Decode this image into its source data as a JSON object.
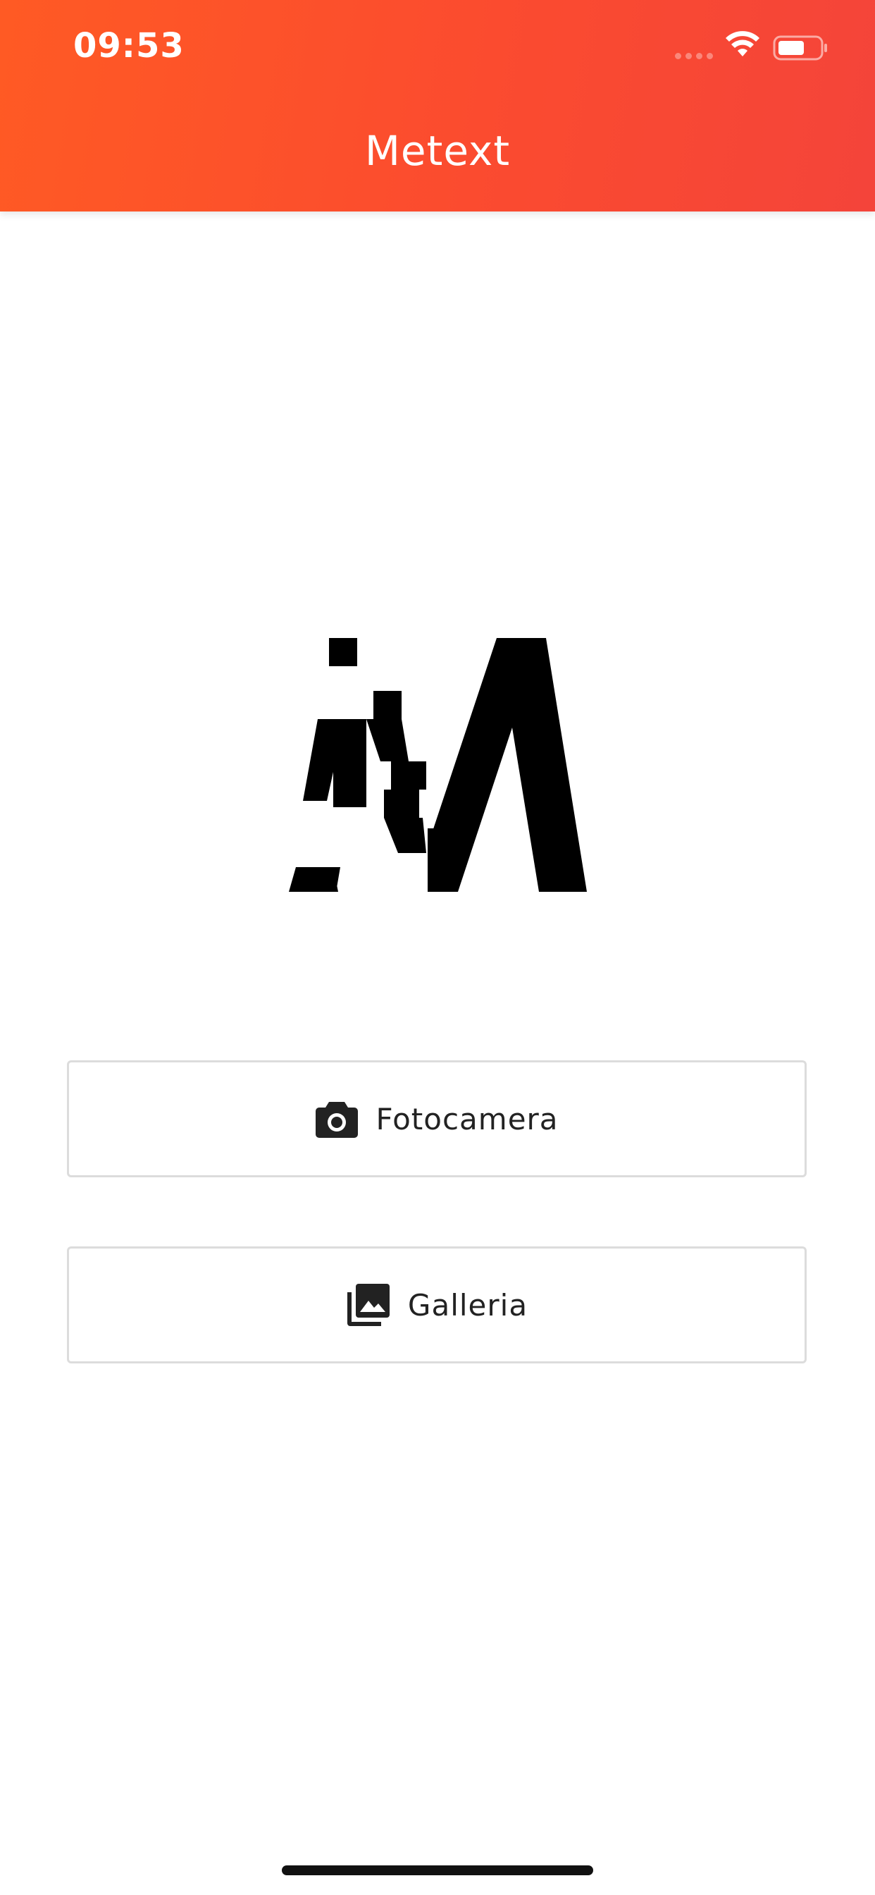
{
  "status_bar": {
    "time": "09:53"
  },
  "header": {
    "title": "Metext",
    "gradient_colors": [
      "#ff5a24",
      "#f4443a"
    ]
  },
  "logo": {
    "name": "metext-logo",
    "color": "#000000"
  },
  "buttons": [
    {
      "label": "Fotocamera",
      "icon": "camera-icon"
    },
    {
      "label": "Galleria",
      "icon": "photo-library-icon"
    }
  ]
}
